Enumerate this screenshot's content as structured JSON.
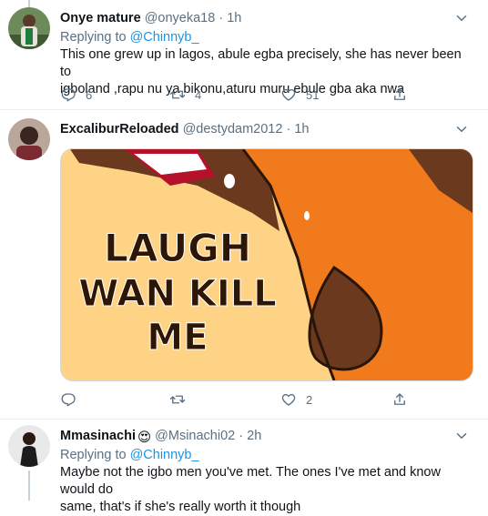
{
  "tweets": [
    {
      "name": "Onye mature",
      "handle": "@onyeka18",
      "time": "1h",
      "separator": "·",
      "replying_prefix": "Replying to",
      "replying_to": "@Chinnyb_",
      "text_line1": "This one grew up in lagos, abule egba precisely, she has never been to",
      "text_line2": "igboland ,rapu nu ya bikonu,aturu muru ebule gba aka nwa",
      "reply_count": "6",
      "retweet_count": "4",
      "like_count": "51"
    },
    {
      "name": "ExcaliburReloaded",
      "handle": "@destydam2012",
      "time": "1h",
      "separator": "·",
      "image_text": [
        "LAUGH",
        "WAN KILL",
        "ME"
      ],
      "reply_count": "",
      "retweet_count": "",
      "like_count": "2"
    },
    {
      "name": "Mmasinachi",
      "name_emoji": "😍",
      "handle": "@Msinachi02",
      "time": "2h",
      "separator": "·",
      "replying_prefix": "Replying to",
      "replying_to": "@Chinnyb_",
      "text_line1": "Maybe not the igbo men you've met. The ones I've met and know would do",
      "text_line2": "same, that's if she's really worth it though"
    }
  ],
  "icons": {
    "reply": "reply-icon",
    "retweet": "retweet-icon",
    "like": "like-icon",
    "share": "share-icon",
    "more": "chevron-down-icon"
  },
  "colors": {
    "accent": "#1b95e0",
    "secondary_text": "#5b7083",
    "divider": "#ebeef0",
    "thread_line": "#c4cfd6"
  }
}
